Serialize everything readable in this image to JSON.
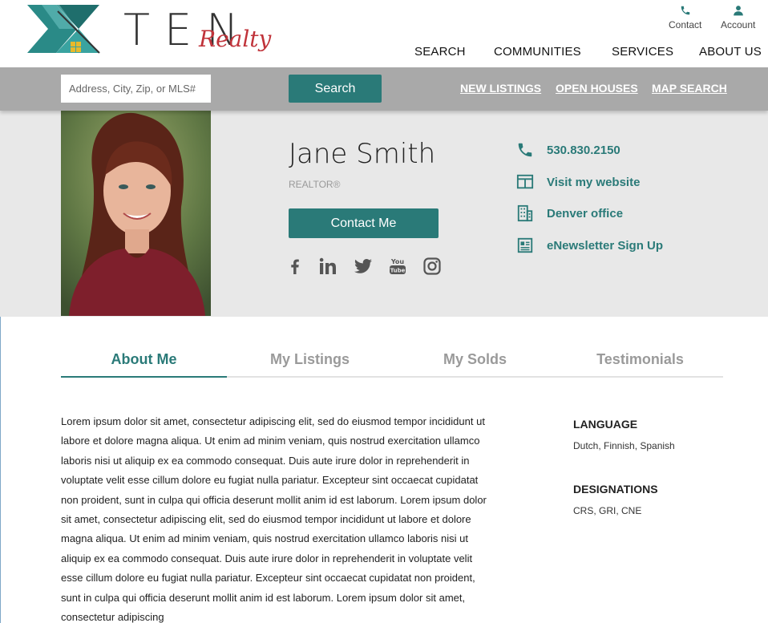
{
  "brand": {
    "logo_word": "TEN",
    "logo_tagline": "Realty",
    "accent": "#2a7a78",
    "brand_red": "#c0333a"
  },
  "header": {
    "utilities": [
      {
        "label": "Contact",
        "icon": "phone-icon"
      },
      {
        "label": "Account",
        "icon": "user-icon"
      }
    ],
    "nav": [
      "SEARCH",
      "COMMUNITIES",
      "SERVICES",
      "ABOUT US"
    ]
  },
  "searchbar": {
    "placeholder": "Address, City, Zip, or MLS#",
    "button_label": "Search",
    "links": [
      "NEW LISTINGS",
      "OPEN HOUSES",
      "MAP SEARCH"
    ]
  },
  "agent": {
    "name": "Jane Smith",
    "title": "REALTOR®",
    "contact_button": "Contact Me",
    "social": [
      "facebook-icon",
      "linkedin-icon",
      "twitter-icon",
      "youtube-icon",
      "instagram-icon"
    ],
    "info": [
      {
        "icon": "phone-icon",
        "label": "530.830.2150"
      },
      {
        "icon": "website-icon",
        "label": "Visit my website"
      },
      {
        "icon": "building-icon",
        "label": "Denver office"
      },
      {
        "icon": "newsletter-icon",
        "label": "eNewsletter Sign Up"
      }
    ]
  },
  "tabs": [
    {
      "label": "About Me",
      "active": true
    },
    {
      "label": "My Listings",
      "active": false
    },
    {
      "label": "My Solds",
      "active": false
    },
    {
      "label": "Testimonials",
      "active": false
    }
  ],
  "bio": "Lorem ipsum dolor sit amet, consectetur adipiscing elit, sed do eiusmod tempor incididunt ut labore et dolore magna aliqua. Ut enim ad minim veniam, quis nostrud exercitation ullamco laboris nisi ut aliquip ex ea commodo consequat. Duis aute irure dolor in reprehenderit in voluptate velit esse cillum dolore eu fugiat nulla pariatur. Excepteur sint occaecat cupidatat non proident, sunt in culpa qui officia deserunt mollit anim id est laborum. Lorem ipsum dolor sit amet, consectetur adipiscing elit, sed do eiusmod tempor incididunt ut labore et dolore magna aliqua. Ut enim ad minim veniam, quis nostrud exercitation ullamco laboris nisi ut aliquip ex ea commodo consequat. Duis aute irure dolor in reprehenderit in voluptate velit esse cillum dolore eu fugiat nulla pariatur. Excepteur sint occaecat cupidatat non proident, sunt in culpa qui officia deserunt mollit anim id est laborum. Lorem ipsum dolor sit amet, consectetur adipiscing",
  "sidebar": {
    "language_heading": "LANGUAGE",
    "language_value": "Dutch, Finnish, Spanish",
    "designations_heading": "DESIGNATIONS",
    "designations_value": "CRS, GRI, CNE"
  }
}
